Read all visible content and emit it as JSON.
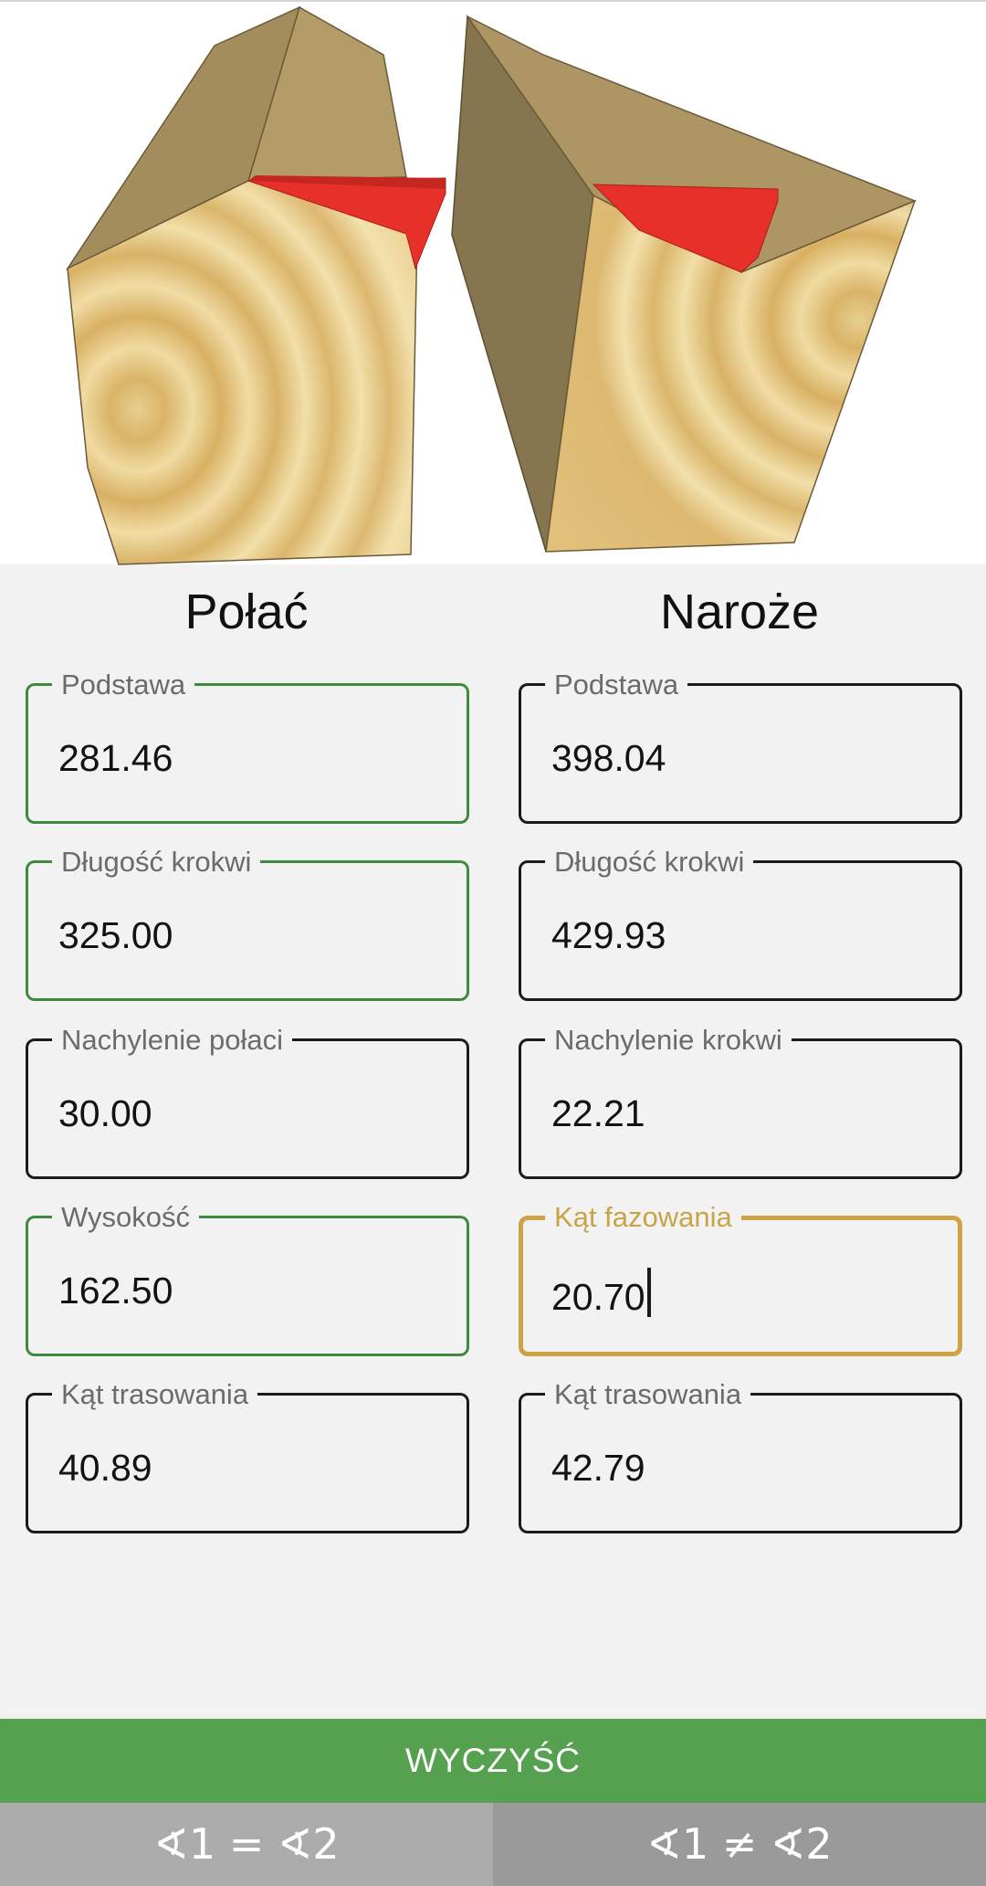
{
  "illustration": {
    "subject": "roof rafter cuts: common rafter and hip rafter",
    "highlight_color": "#e8302a"
  },
  "columns": {
    "left": {
      "title": "Połać",
      "fields": [
        {
          "label": "Podstawa",
          "value": "281.46",
          "state": "computed"
        },
        {
          "label": "Długość krokwi",
          "value": "325.00",
          "state": "computed"
        },
        {
          "label": "Nachylenie połaci",
          "value": "30.00",
          "state": "input"
        },
        {
          "label": "Wysokość",
          "value": "162.50",
          "state": "computed"
        },
        {
          "label": "Kąt trasowania",
          "value": "40.89",
          "state": "input"
        }
      ]
    },
    "right": {
      "title": "Naroże",
      "fields": [
        {
          "label": "Podstawa",
          "value": "398.04",
          "state": "input"
        },
        {
          "label": "Długość krokwi",
          "value": "429.93",
          "state": "input"
        },
        {
          "label": "Nachylenie krokwi",
          "value": "22.21",
          "state": "input"
        },
        {
          "label": "Kąt fazowania",
          "value": "20.70",
          "state": "focused"
        },
        {
          "label": "Kąt trasowania",
          "value": "42.79",
          "state": "input"
        }
      ]
    }
  },
  "actions": {
    "clear_label": "WYCZYŚĆ",
    "mode_equal_label": "∢1 = ∢2",
    "mode_not_equal_label": "∢1 ≠ ∢2"
  },
  "colors": {
    "computed_border": "#3f8a3c",
    "focused_border": "#cfa343",
    "clear_button": "#55a14f"
  }
}
